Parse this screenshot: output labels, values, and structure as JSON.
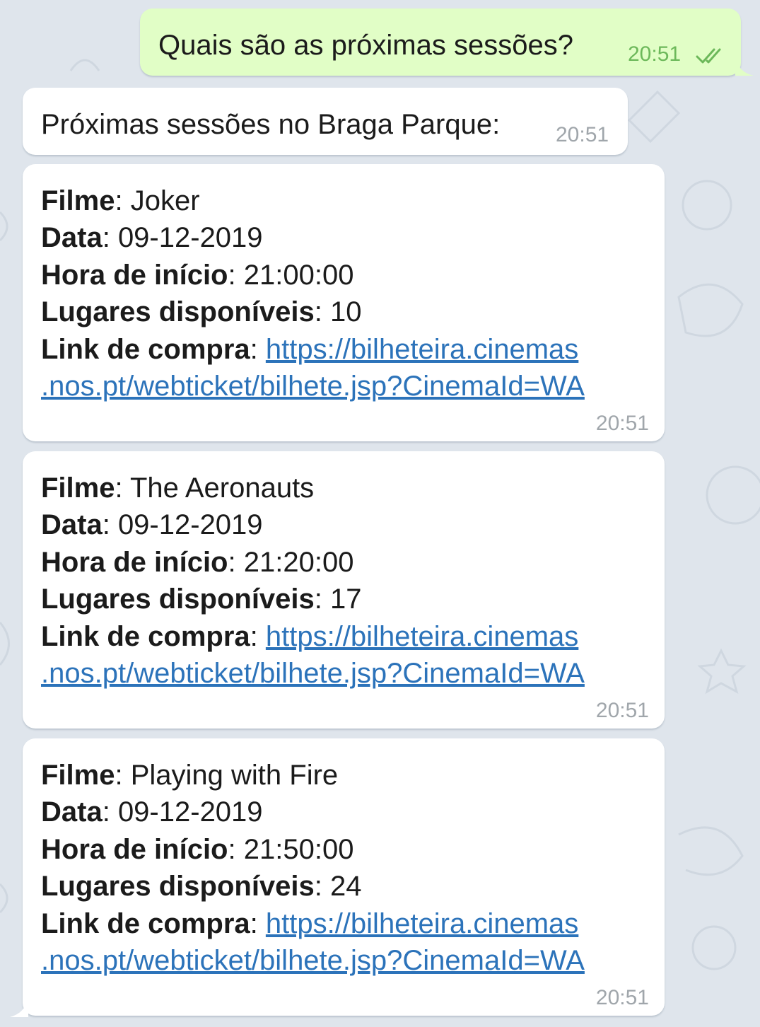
{
  "conversation": {
    "outgoing": {
      "text": "Quais são as próximas sessões?",
      "time": "20:51",
      "status_icon": "double-check-icon"
    },
    "greeting": {
      "text": "Próximas sessões no Braga Parque:",
      "time": "20:51"
    },
    "labels": {
      "film": "Filme",
      "date": "Data",
      "start": "Hora de início",
      "seats": "Lugares disponíveis",
      "link": "Link de compra",
      "separator": ": "
    },
    "sessions": [
      {
        "film": "Joker",
        "date": "09-12-2019",
        "start": "21:00:00",
        "seats": "10",
        "link_line1": "https://bilheteira.cinemas",
        "link_line2": ".nos.pt/webticket/bilhete.jsp?CinemaId=WA",
        "time": "20:51"
      },
      {
        "film": "The Aeronauts",
        "date": "09-12-2019",
        "start": "21:20:00",
        "seats": "17",
        "link_line1": "https://bilheteira.cinemas",
        "link_line2": ".nos.pt/webticket/bilhete.jsp?CinemaId=WA",
        "time": "20:51"
      },
      {
        "film": "Playing with Fire",
        "date": "09-12-2019",
        "start": "21:50:00",
        "seats": "24",
        "link_line1": "https://bilheteira.cinemas",
        "link_line2": ".nos.pt/webticket/bilhete.jsp?CinemaId=WA",
        "time": "20:51"
      }
    ]
  },
  "colors": {
    "background": "#dfe5ec",
    "outgoing_bubble": "#e1fec6",
    "incoming_bubble": "#ffffff",
    "link": "#2c73ba",
    "outgoing_time": "#6cb85a",
    "incoming_time": "#a0a6ab"
  }
}
